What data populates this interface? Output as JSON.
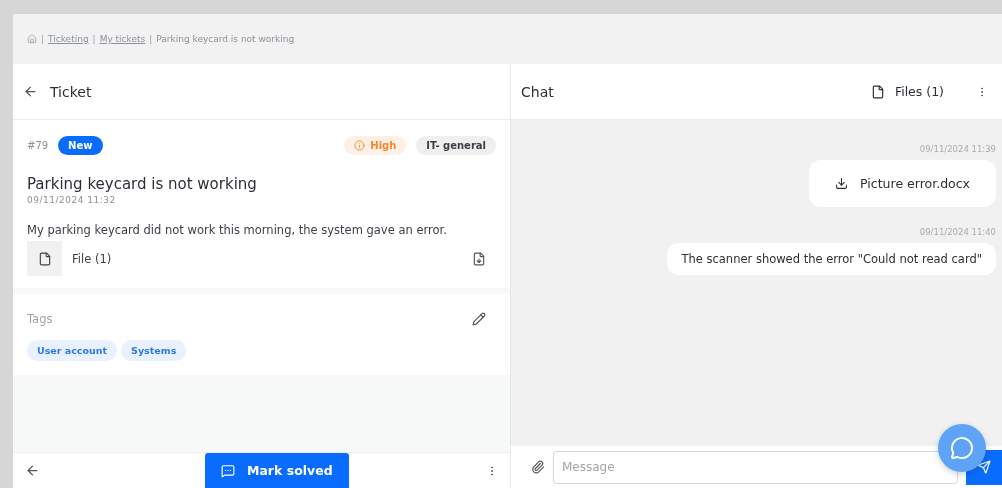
{
  "breadcrumb": [
    {
      "separator": "|",
      "label": "Ticketing",
      "link": true
    },
    {
      "separator": "|",
      "label": "My tickets",
      "link": true
    },
    {
      "separator": "|",
      "label": "Parking keycard is not working",
      "link": false
    }
  ],
  "ticket_panel": {
    "title": "Ticket",
    "number": "#79",
    "status": "New",
    "priority": "High",
    "category": "IT- general",
    "subject": "Parking keycard is not working",
    "date": "09/11/2024 11:32",
    "description": "My parking keycard did not work this morning, the system gave an error.",
    "attachment": "File (1)"
  },
  "tags": {
    "label": "Tags",
    "items": [
      {
        "label": "User account"
      },
      {
        "label": "Systems"
      }
    ]
  },
  "footer": {
    "action": "Mark solved"
  },
  "chat": {
    "title": "Chat",
    "files": "Files (1)",
    "messages": [
      {
        "kind": "file",
        "time": "09/11/2024 11:39",
        "text": "Picture error.docx"
      },
      {
        "kind": "text",
        "time": "09/11/2024 11:40",
        "text": "The scanner showed the error \"Could not read card\""
      }
    ],
    "input": {
      "placeholder": "Message"
    }
  }
}
